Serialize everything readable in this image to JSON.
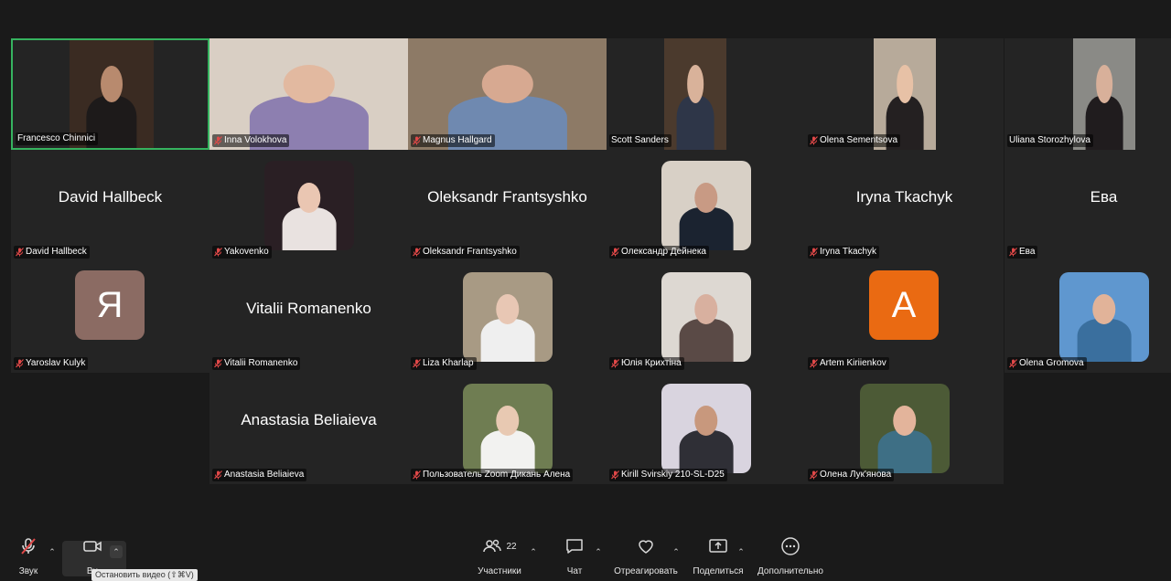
{
  "participants": [
    {
      "name": "Francesco Chinnici",
      "muted": false,
      "kind": "video-full",
      "bg": "#3a2b22",
      "fg": "#1d1a1a",
      "skin": "#b88a6e",
      "active": true
    },
    {
      "name": "Inna Volokhova",
      "muted": true,
      "kind": "video-full",
      "bg": "#d9cfc4",
      "fg": "#8d7fb0",
      "skin": "#e2b9a0"
    },
    {
      "name": "Magnus Hallgard",
      "muted": true,
      "kind": "video-full",
      "bg": "#8d7a66",
      "fg": "#6f89b0",
      "skin": "#d7a991"
    },
    {
      "name": "Scott Sanders",
      "muted": false,
      "kind": "video",
      "bg": "#4b3a2d",
      "fg": "#2e3648",
      "skin": "#d9b29a"
    },
    {
      "name": "Olena Sementsova",
      "muted": true,
      "kind": "video",
      "bg": "#b7aa9a",
      "fg": "#242021",
      "skin": "#e7c1a6"
    },
    {
      "name": "Uliana Storozhylova",
      "muted": false,
      "kind": "video",
      "bg": "#8a8a86",
      "fg": "#201c1e",
      "skin": "#d8b09a"
    },
    {
      "name": "David Hallbeck",
      "muted": true,
      "kind": "name",
      "center": "David Hallbeck"
    },
    {
      "name": "Yakovenko",
      "muted": true,
      "kind": "video",
      "bg": "#2a1f24",
      "fg": "#e9e2e0",
      "skin": "#eac6b2"
    },
    {
      "name": "Oleksandr Frantsyshko",
      "muted": true,
      "kind": "name",
      "center": "Oleksandr Frantsyshko"
    },
    {
      "name": "Олександр Дейнека",
      "muted": true,
      "kind": "video",
      "bg": "#d8d0c6",
      "fg": "#1b2330",
      "skin": "#c89a84"
    },
    {
      "name": "Iryna Tkachyk",
      "muted": true,
      "kind": "name",
      "center": "Iryna Tkachyk"
    },
    {
      "name": "Ева",
      "muted": true,
      "kind": "name",
      "center": "Ева"
    },
    {
      "name": "Yaroslav Kulyk",
      "muted": true,
      "kind": "avatar",
      "letter": "Я",
      "avatar_color": "#8b6b63"
    },
    {
      "name": "Vitalii Romanenko",
      "muted": true,
      "kind": "name",
      "center": "Vitalii Romanenko"
    },
    {
      "name": "Liza Kharlap",
      "muted": true,
      "kind": "video",
      "bg": "#a89a84",
      "fg": "#efefef",
      "skin": "#e8c7b4"
    },
    {
      "name": "Юлія Крихтіна",
      "muted": true,
      "kind": "video",
      "bg": "#ddd8d2",
      "fg": "#5a4a46",
      "skin": "#d8b09f"
    },
    {
      "name": "Artem Kiriienkov",
      "muted": true,
      "kind": "avatar",
      "letter": "A",
      "avatar_color": "#ea6a12"
    },
    {
      "name": "Olena Gromova",
      "muted": true,
      "kind": "video",
      "bg": "#5f97cf",
      "fg": "#3a6f9e",
      "skin": "#e1b399"
    },
    {
      "name": "Anastasia Beliaieva",
      "muted": true,
      "kind": "name",
      "center": "Anastasia Beliaieva"
    },
    {
      "name": "Пользователь Zoom Дикань Алена",
      "muted": true,
      "kind": "video",
      "bg": "#6f7d52",
      "fg": "#f2f2f0",
      "skin": "#e8c9b2"
    },
    {
      "name": "Kirill Svirskiy 210-SL-D25",
      "muted": true,
      "kind": "video",
      "bg": "#d9d4df",
      "fg": "#2f2f36",
      "skin": "#c8987d"
    },
    {
      "name": "Олена Лук'янова",
      "muted": true,
      "kind": "video",
      "bg": "#4c5a36",
      "fg": "#3e6f85",
      "skin": "#e3b49b"
    }
  ],
  "toolbar": {
    "audio_label": "Звук",
    "video_label": "Ви",
    "tooltip": "Остановить видео (⇧⌘V)",
    "participants_label": "Участники",
    "participants_count": "22",
    "chat_label": "Чат",
    "react_label": "Отреагировать",
    "share_label": "Поделиться",
    "more_label": "Дополнительно"
  },
  "colors": {
    "active_border": "#36b35f",
    "muted_icon": "#e04848",
    "tile_bg": "#242424",
    "page_bg": "#1a1a1a"
  },
  "icons": {
    "audio": "mic-muted-icon",
    "video": "camera-icon",
    "participants": "people-icon",
    "chat": "chat-bubble-icon",
    "react": "heart-icon",
    "share": "share-screen-icon",
    "more": "more-dots-icon"
  }
}
